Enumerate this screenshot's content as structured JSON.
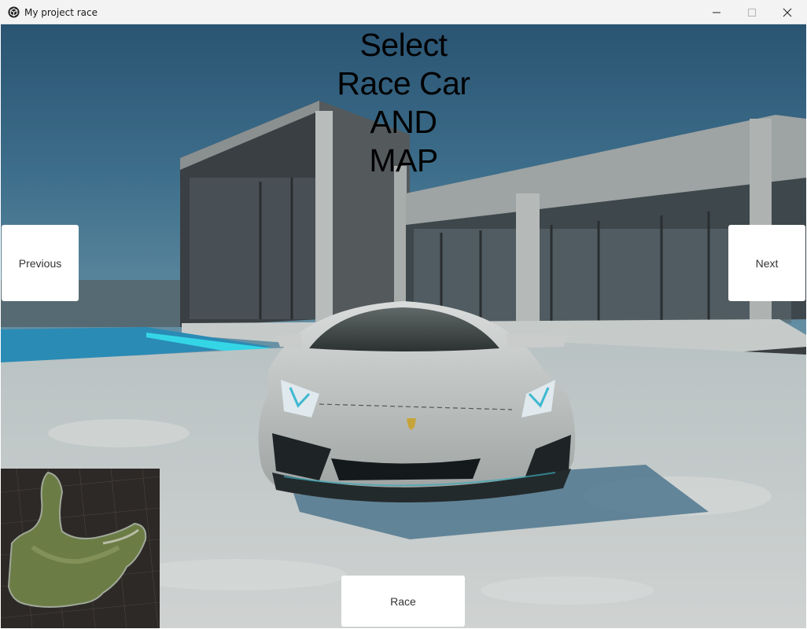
{
  "window": {
    "title": "My project race",
    "app_icon": "unity-cube-icon",
    "controls": [
      "minimize-icon",
      "maximize-icon",
      "close-icon"
    ]
  },
  "game": {
    "headline_lines": [
      "Select",
      "Race Car",
      "AND",
      "MAP"
    ],
    "previous_label": "Previous",
    "next_label": "Next",
    "race_label": "Race"
  },
  "colors": {
    "sky": "#2f5a77",
    "ground": "#c9cdcc",
    "pool": "#1d8fbd",
    "button_bg": "#ffffff",
    "headline": "#000000"
  }
}
